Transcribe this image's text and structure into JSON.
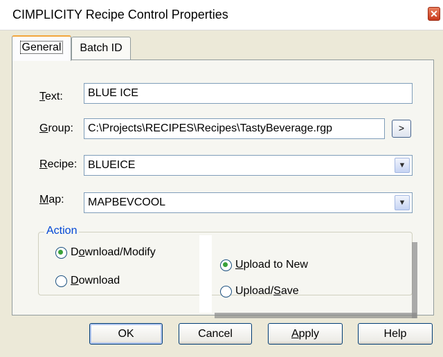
{
  "window": {
    "title": "CIMPLICITY Recipe Control Properties",
    "close_glyph": "✕"
  },
  "tabs": [
    {
      "label": "General"
    },
    {
      "label": "Batch ID"
    }
  ],
  "fields": {
    "text": {
      "label_accel": "T",
      "label_rest": "ext:",
      "value": "BLUE ICE"
    },
    "group": {
      "label_accel": "G",
      "label_rest": "roup:",
      "value": "C:\\Projects\\RECIPES\\Recipes\\TastyBeverage.rgp",
      "browse_label": ">"
    },
    "recipe": {
      "label_accel": "R",
      "label_rest": "ecipe:",
      "value": "BLUEICE"
    },
    "map": {
      "label_accel": "M",
      "label_rest": "ap:",
      "value": "MAPBEVCOOL"
    }
  },
  "dropdown_glyph": "▼",
  "action": {
    "legend": "Action",
    "options": [
      {
        "pre": "D",
        "accel": "o",
        "post": "wnload/Modify",
        "checked": true
      },
      {
        "pre": "",
        "accel": "D",
        "post": "ownload",
        "checked": false
      },
      {
        "pre": "",
        "accel": "U",
        "post": "pload to New",
        "checked": true
      },
      {
        "pre": "Upload/",
        "accel": "S",
        "post": "ave",
        "checked": false
      }
    ]
  },
  "buttons": {
    "ok": "OK",
    "cancel": "Cancel",
    "apply_accel": "A",
    "apply_rest": "pply",
    "help": "Help"
  }
}
